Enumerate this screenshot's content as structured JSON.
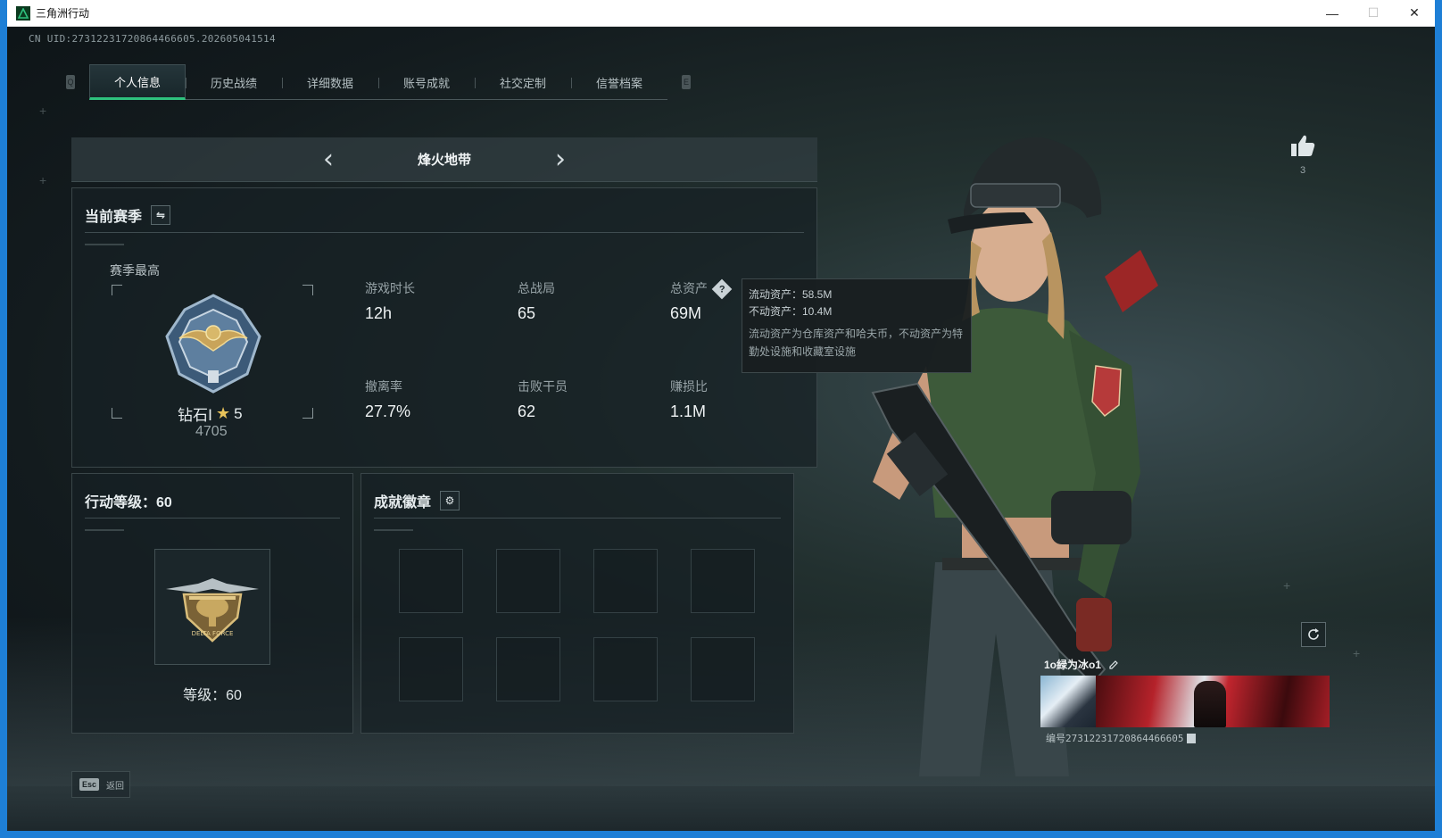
{
  "window": {
    "title": "三角洲行动",
    "controls": {
      "minimize": "—",
      "maximize": "☐",
      "close": "✕"
    }
  },
  "uid_text": "CN UID:27312231720864466605.202605041514",
  "tabs": {
    "left_key": "Q",
    "right_key": "E",
    "items": [
      {
        "label": "个人信息",
        "active": true
      },
      {
        "label": "历史战绩",
        "active": false
      },
      {
        "label": "详细数据",
        "active": false
      },
      {
        "label": "账号成就",
        "active": false
      },
      {
        "label": "社交定制",
        "active": false
      },
      {
        "label": "信誉档案",
        "active": false
      }
    ]
  },
  "mode": {
    "title": "烽火地带",
    "prev": "‹",
    "next": "›"
  },
  "season": {
    "title": "当前赛季",
    "switch_icon": "⇋",
    "best_label": "赛季最高",
    "rank_name": "钻石Ⅰ",
    "rank_stars": "5",
    "rank_score": "4705",
    "stats": [
      {
        "label": "游戏时长",
        "value": "12h"
      },
      {
        "label": "总战局",
        "value": "65"
      },
      {
        "label": "总资产",
        "value": "69M",
        "help": "?"
      },
      {
        "label": "撤离率",
        "value": "27.7%"
      },
      {
        "label": "击败干员",
        "value": "62"
      },
      {
        "label": "赚损比",
        "value": "1.1M"
      }
    ]
  },
  "tooltip": {
    "line1": "流动资产：58.5M",
    "line2": "不动资产：10.4M",
    "note": "流动资产为仓库资产和哈夫币，不动资产为特勤处设施和收藏室设施"
  },
  "level": {
    "title": "行动等级：60",
    "level_text": "等级：60",
    "badge_text": "DELTA FORCE"
  },
  "achievements": {
    "title": "成就徽章",
    "gear_icon": "⚙",
    "slot_count": 8
  },
  "social": {
    "like_count": "3",
    "player_name": "1o緑为冰o1",
    "player_id": "编号27312231720864466605"
  },
  "footer": {
    "esc_key": "Esc",
    "esc_label": "返回"
  },
  "colors": {
    "accent_green": "#2ec27e",
    "star_gold": "#e8c35a",
    "window_border": "#1e7fd6"
  },
  "icons": [
    "app-logo-icon",
    "switch-icon",
    "help-icon",
    "gear-icon",
    "thumbs-up-icon",
    "refresh-icon",
    "edit-icon",
    "copy-icon"
  ]
}
